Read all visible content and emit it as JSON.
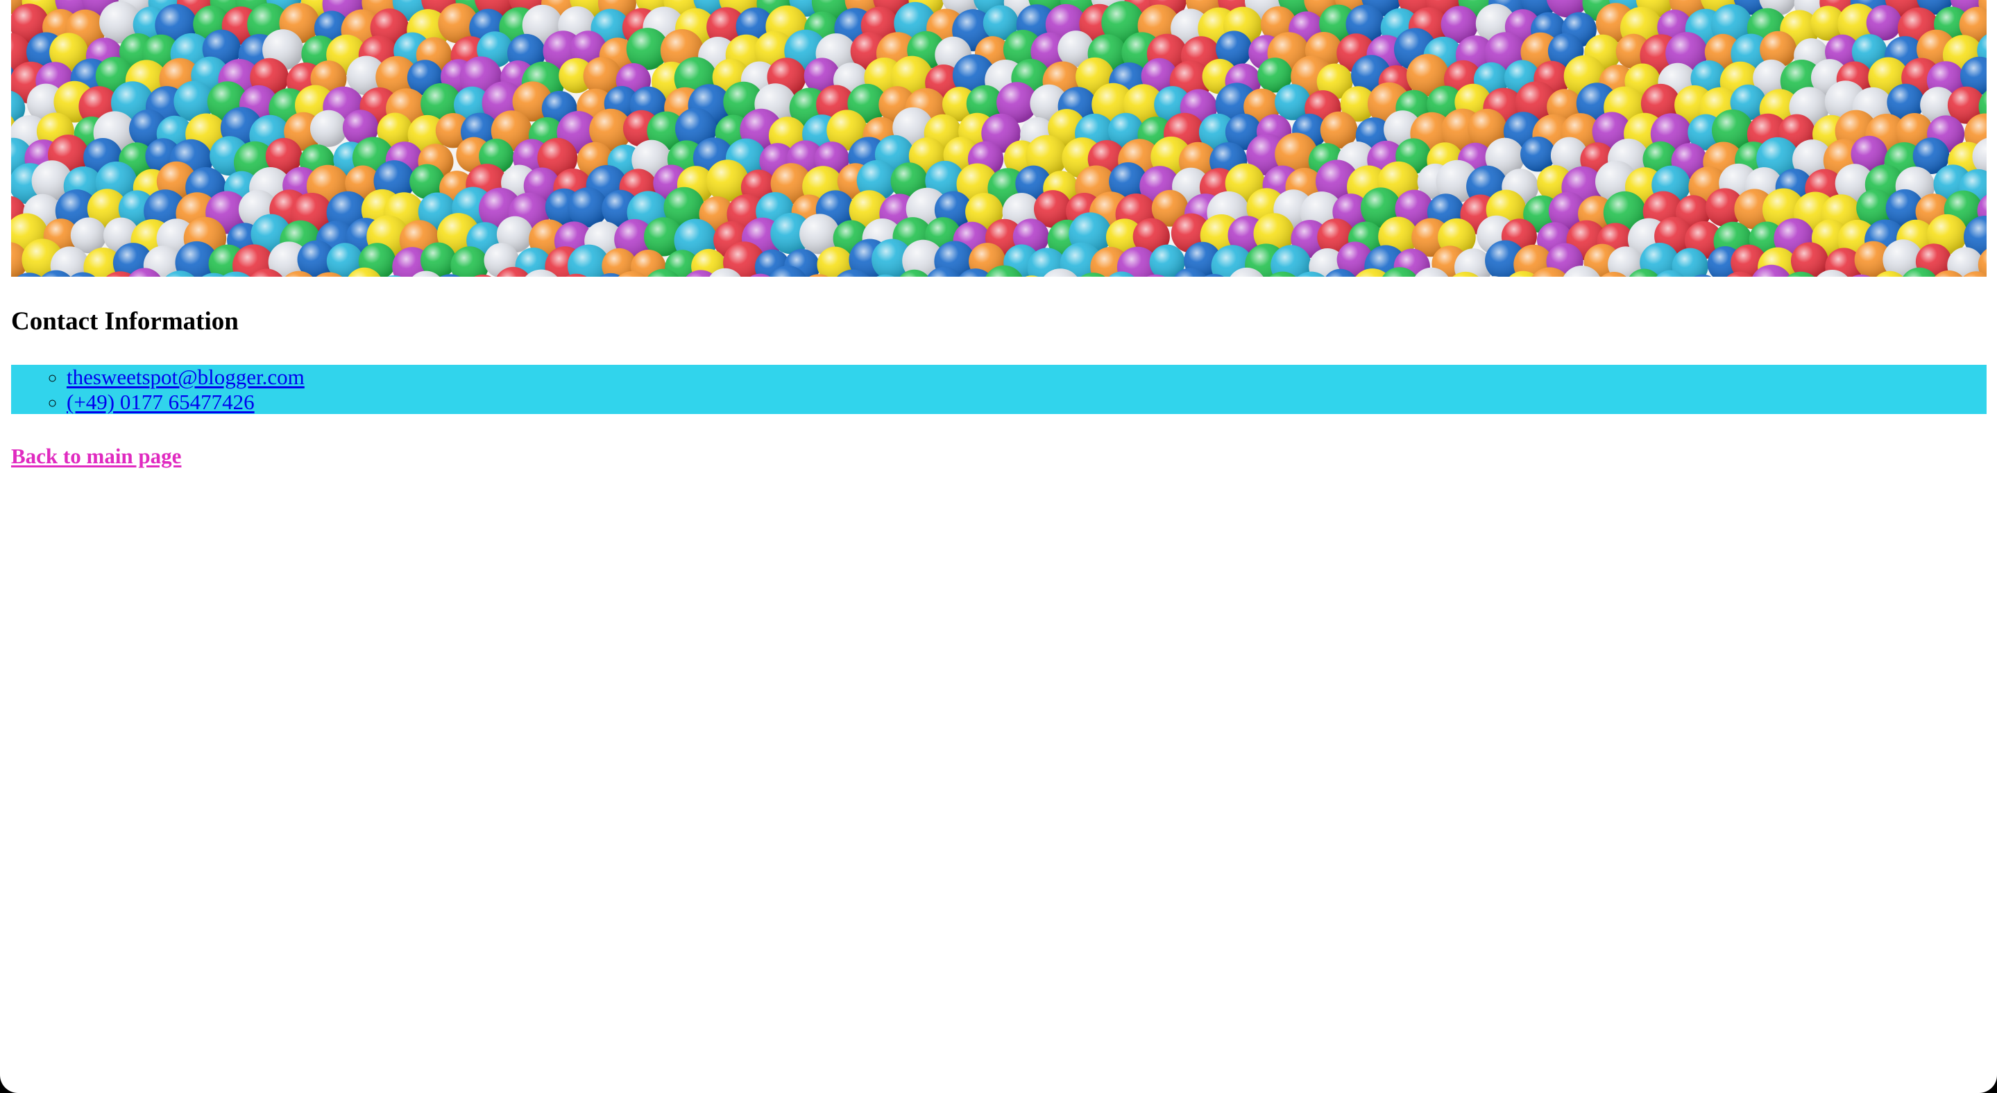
{
  "banner": {
    "icon": "ball-pit-image",
    "palette": [
      "#f7e017",
      "#27b6dd",
      "#1567c9",
      "#e7303d",
      "#b23dc9",
      "#20c04c",
      "#f7922a",
      "#e0e3ea"
    ]
  },
  "contact": {
    "heading": "Contact Information",
    "list_color": "#31d4ec",
    "link_color": "#0000ee",
    "email": "thesweetspot@blogger.com",
    "phone": "(+49) 0177 65477426"
  },
  "footer": {
    "back_label": "Back to main page",
    "back_color": "#e02ac0"
  }
}
